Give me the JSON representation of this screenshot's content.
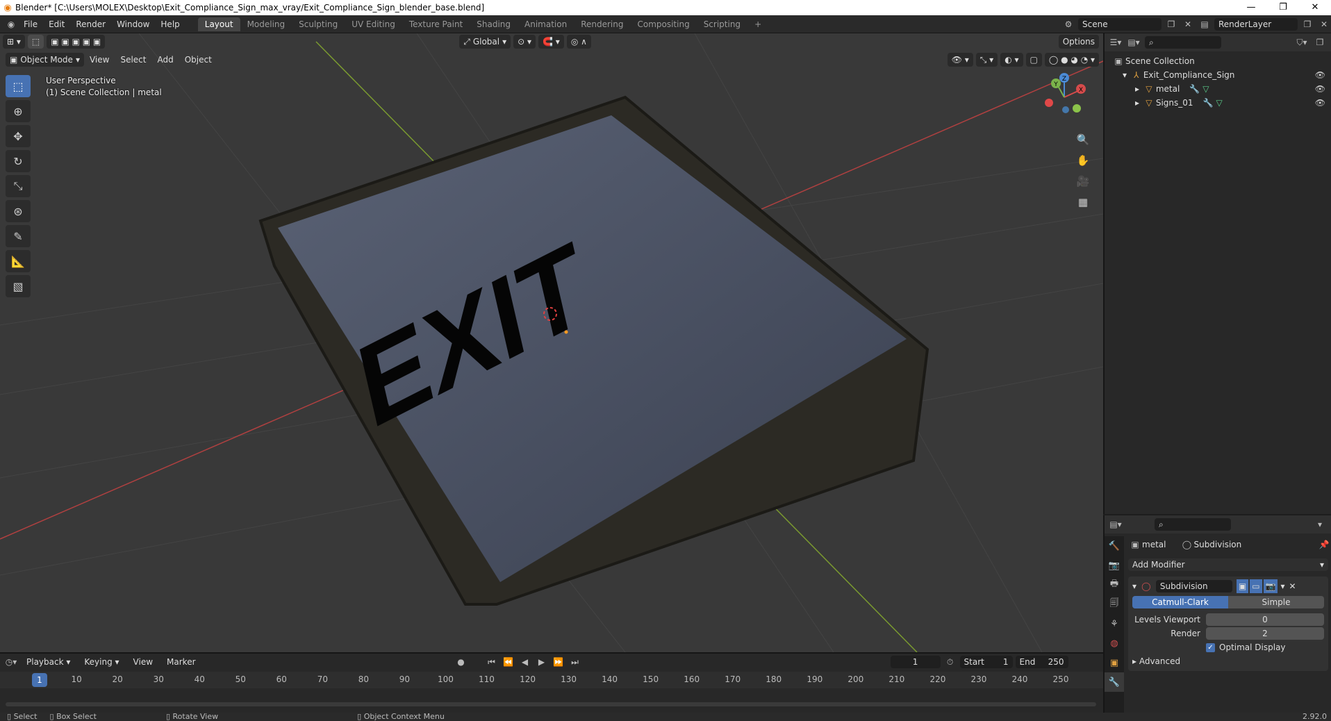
{
  "window": {
    "title": "Blender* [C:\\Users\\MOLEX\\Desktop\\Exit_Compliance_Sign_max_vray/Exit_Compliance_Sign_blender_base.blend]"
  },
  "menu": [
    "File",
    "Edit",
    "Render",
    "Window",
    "Help"
  ],
  "workspaces": [
    "Layout",
    "Modeling",
    "Sculpting",
    "UV Editing",
    "Texture Paint",
    "Shading",
    "Animation",
    "Rendering",
    "Compositing",
    "Scripting"
  ],
  "scene": {
    "name": "Scene",
    "render_layer": "RenderLayer"
  },
  "viewport": {
    "mode": "Object Mode",
    "menus": [
      "View",
      "Select",
      "Add",
      "Object"
    ],
    "transform": "Global",
    "options": "Options",
    "perspective": "User Perspective",
    "collection_info": "(1) Scene Collection | metal",
    "sign_text": "EXIT"
  },
  "outliner": {
    "root": "Scene Collection",
    "items": [
      {
        "label": "Exit_Compliance_Sign"
      },
      {
        "label": "metal"
      },
      {
        "label": "Signs_01"
      }
    ]
  },
  "properties": {
    "object": "metal",
    "modifier_crumb": "Subdivision",
    "add_modifier": "Add Modifier",
    "modifier_name": "Subdivision",
    "tab_catmull": "Catmull-Clark",
    "tab_simple": "Simple",
    "levels_viewport_label": "Levels Viewport",
    "levels_viewport": "0",
    "render_label": "Render",
    "render": "2",
    "optimal_display": "Optimal Display",
    "advanced": "Advanced"
  },
  "timeline": {
    "menus": [
      "Playback",
      "Keying",
      "View",
      "Marker"
    ],
    "current_frame": "1",
    "start_label": "Start",
    "start": "1",
    "end_label": "End",
    "end": "250",
    "ruler": [
      "1",
      "10",
      "20",
      "30",
      "40",
      "50",
      "60",
      "70",
      "80",
      "90",
      "100",
      "110",
      "120",
      "130",
      "140",
      "150",
      "160",
      "170",
      "180",
      "190",
      "200",
      "210",
      "220",
      "230",
      "240",
      "250"
    ]
  },
  "statusbar": {
    "select": "Select",
    "box_select": "Box Select",
    "rotate": "Rotate View",
    "context": "Object Context Menu",
    "version": "2.92.0"
  }
}
